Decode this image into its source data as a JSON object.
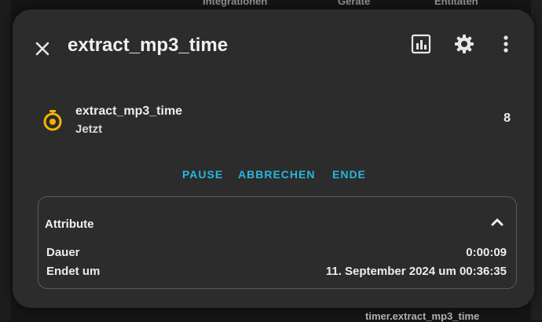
{
  "background": {
    "nav": [
      "Integrationen",
      "Geräte",
      "Entitäten"
    ],
    "footer_text": "timer.extract_mp3_time"
  },
  "dialog": {
    "title": "extract_mp3_time",
    "icons": [
      "close-icon",
      "history-chart-icon",
      "settings-gear-icon",
      "more-vertical-icon"
    ]
  },
  "entity": {
    "name": "extract_mp3_time",
    "subtitle": "Jetzt",
    "value": "8",
    "icon": "timer-icon",
    "icon_color": "#f5b400"
  },
  "actions": [
    "PAUSE",
    "ABBRECHEN",
    "ENDE"
  ],
  "accent_color": "#27b6e0",
  "attributes": {
    "title": "Attribute",
    "expanded": true,
    "rows": [
      {
        "key": "Dauer",
        "value": "0:00:09"
      },
      {
        "key": "Endet um",
        "value": "11. September 2024 um 00:36:35"
      }
    ]
  }
}
